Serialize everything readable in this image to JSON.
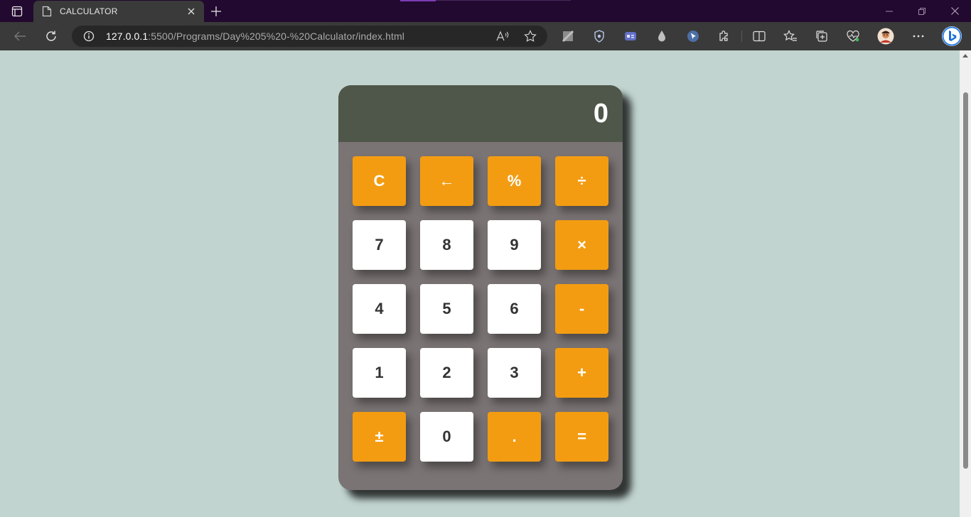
{
  "browser": {
    "tab_title": "CALCULATOR",
    "url_host": "127.0.0.1",
    "url_rest": ":5500/Programs/Day%205%20-%20Calculator/index.html"
  },
  "colors": {
    "page_background": "#c1d4d0",
    "display_background": "#4e5749",
    "body_background": "#7b7474",
    "operator_key": "#f39c12",
    "number_key": "#ffffff"
  },
  "calculator": {
    "display": "0",
    "keys": [
      {
        "label": "C",
        "kind": "op",
        "name": "clear-button"
      },
      {
        "label": "←",
        "kind": "op",
        "name": "backspace-button"
      },
      {
        "label": "%",
        "kind": "op",
        "name": "percent-button"
      },
      {
        "label": "÷",
        "kind": "op",
        "name": "divide-button"
      },
      {
        "label": "7",
        "kind": "num",
        "name": "digit-7-button"
      },
      {
        "label": "8",
        "kind": "num",
        "name": "digit-8-button"
      },
      {
        "label": "9",
        "kind": "num",
        "name": "digit-9-button"
      },
      {
        "label": "×",
        "kind": "op",
        "name": "multiply-button"
      },
      {
        "label": "4",
        "kind": "num",
        "name": "digit-4-button"
      },
      {
        "label": "5",
        "kind": "num",
        "name": "digit-5-button"
      },
      {
        "label": "6",
        "kind": "num",
        "name": "digit-6-button"
      },
      {
        "label": "-",
        "kind": "op",
        "name": "subtract-button"
      },
      {
        "label": "1",
        "kind": "num",
        "name": "digit-1-button"
      },
      {
        "label": "2",
        "kind": "num",
        "name": "digit-2-button"
      },
      {
        "label": "3",
        "kind": "num",
        "name": "digit-3-button"
      },
      {
        "label": "+",
        "kind": "op",
        "name": "add-button"
      },
      {
        "label": "±",
        "kind": "op",
        "name": "plus-minus-button"
      },
      {
        "label": "0",
        "kind": "num",
        "name": "digit-0-button"
      },
      {
        "label": ".",
        "kind": "op",
        "name": "decimal-button"
      },
      {
        "label": "=",
        "kind": "op",
        "name": "equals-button"
      }
    ]
  }
}
